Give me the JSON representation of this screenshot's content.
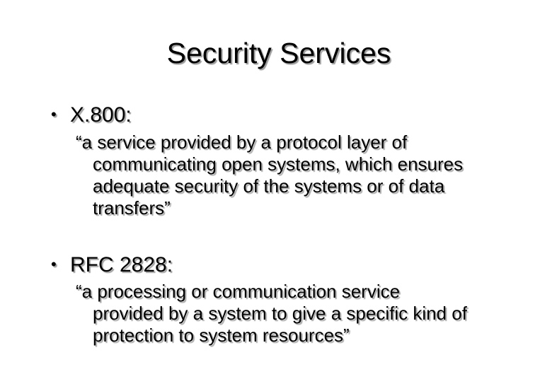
{
  "slide": {
    "title": "Security Services",
    "bullets": [
      {
        "marker": "•",
        "label": "X.800:",
        "quote_lines": [
          "“a service provided by a protocol layer of",
          "communicating open systems, which ensures",
          "adequate security of the systems or of data",
          "transfers”"
        ]
      },
      {
        "marker": "•",
        "label": "RFC 2828:",
        "quote_lines": [
          "“a processing or communication service",
          "provided by a system to give a specific kind of",
          "protection to system resources”"
        ]
      }
    ]
  }
}
